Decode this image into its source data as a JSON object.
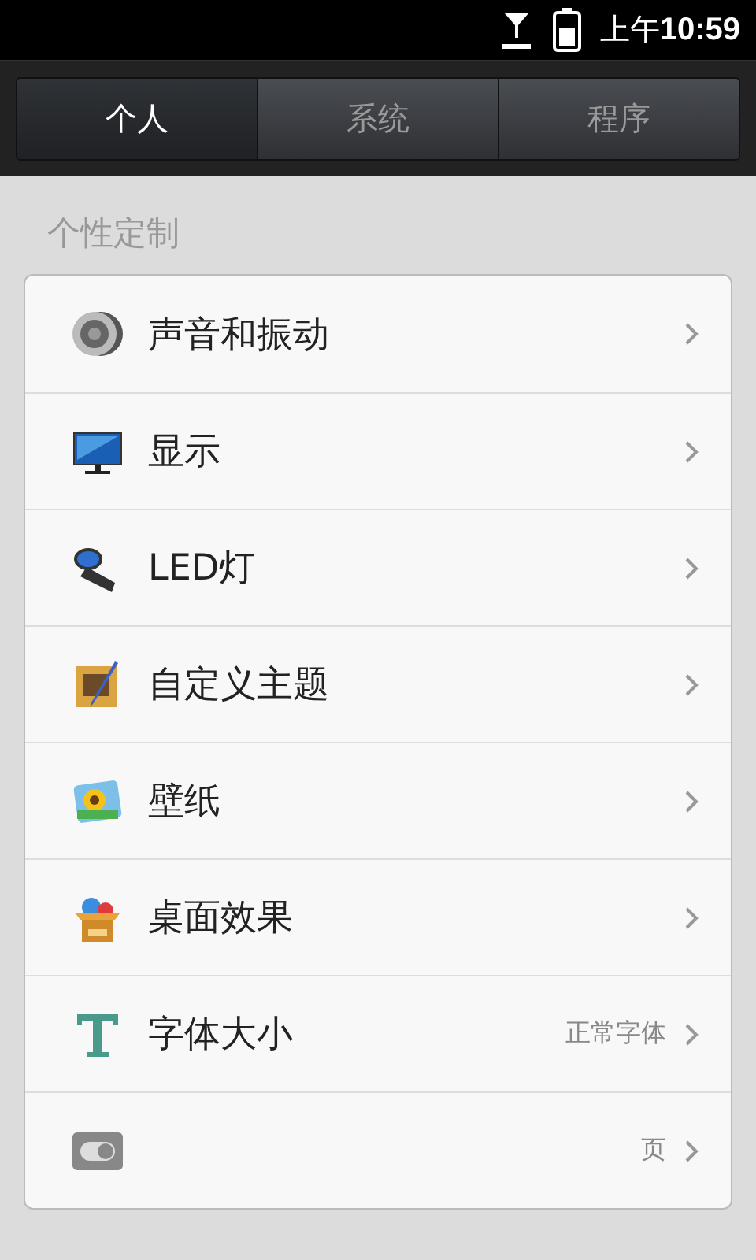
{
  "status_bar": {
    "time_prefix": "上午",
    "time": "10:59"
  },
  "tabs": [
    {
      "label": "个人",
      "selected": true
    },
    {
      "label": "系统",
      "selected": false
    },
    {
      "label": "程序",
      "selected": false
    }
  ],
  "section": {
    "title": "个性定制"
  },
  "items": [
    {
      "label": "声音和振动"
    },
    {
      "label": "显示"
    },
    {
      "label": "LED灯"
    },
    {
      "label": "自定义主题"
    },
    {
      "label": "壁纸"
    },
    {
      "label": "桌面效果"
    },
    {
      "label": "字体大小",
      "value": "正常字体"
    },
    {
      "value": "页"
    }
  ]
}
